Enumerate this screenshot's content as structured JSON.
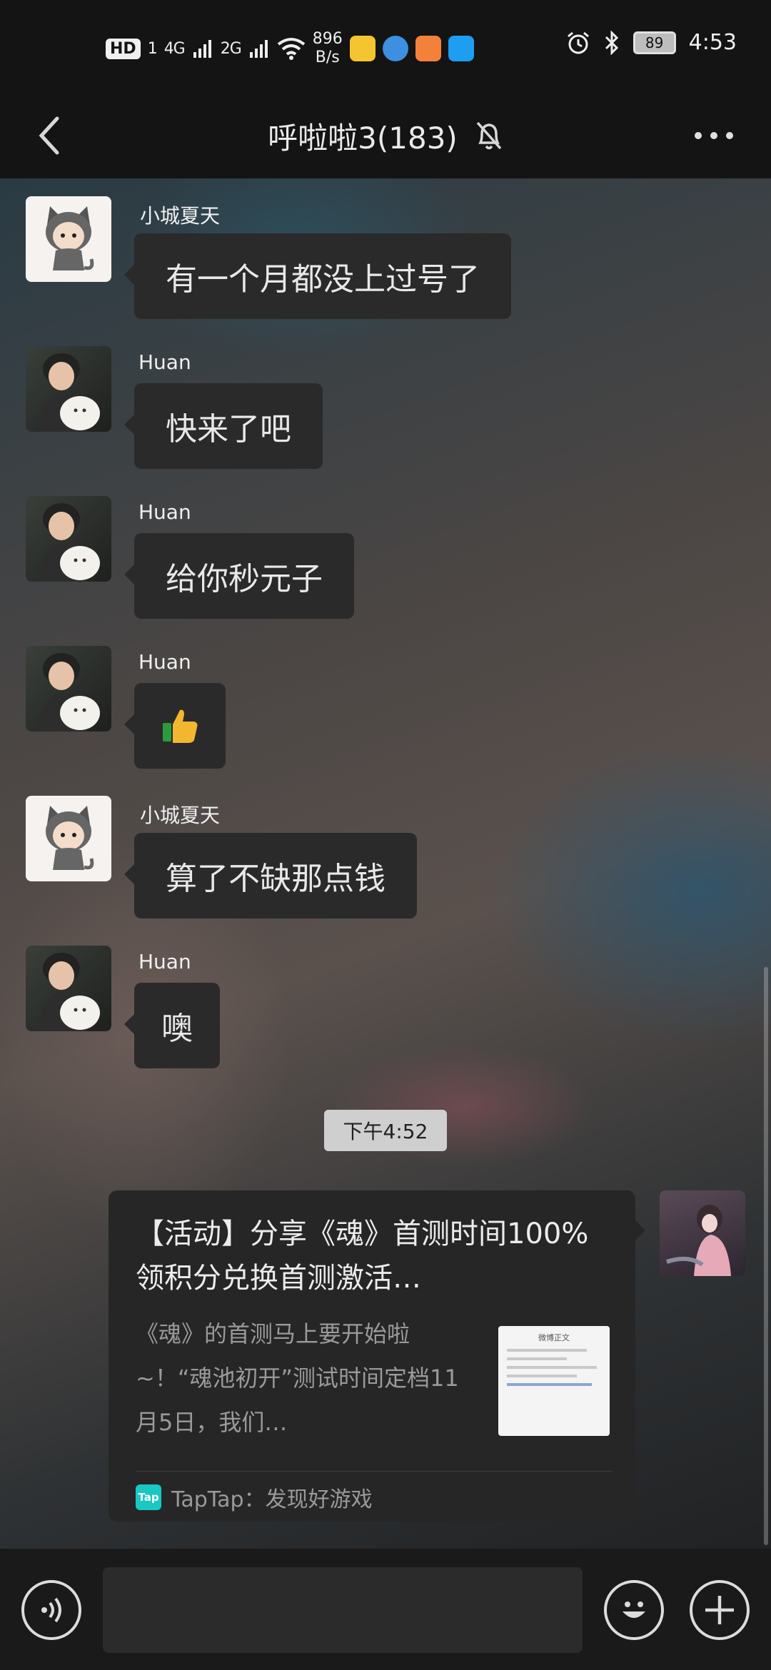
{
  "status_bar": {
    "hd": "HD",
    "sim1": "1",
    "signal_4g": "4G",
    "signal_2g": "2G",
    "net_speed_value": "896",
    "net_speed_unit": "B/s",
    "battery": "89",
    "time": "4:53"
  },
  "header": {
    "title": "呼啦啦3(183)"
  },
  "messages": [
    {
      "sender": "小城夏天",
      "text": "有一个月都没上过号了"
    },
    {
      "sender": "Huan",
      "text": "快来了吧"
    },
    {
      "sender": "Huan",
      "text": "给你秒元子"
    },
    {
      "sender": "Huan",
      "text": "👍"
    },
    {
      "sender": "小城夏天",
      "text": "算了不缺那点钱"
    },
    {
      "sender": "Huan",
      "text": "噢"
    }
  ],
  "timestamp": "下午4:52",
  "share_card": {
    "title": "【活动】分享《魂》首测时间100%领积分兑换首测激活…",
    "body": "《魂》的首测马上要开始啦~！“魂池初开”测试时间定档11月5日，我们…",
    "thumb_header": "微博正文",
    "source_logo": "Tap",
    "source": "TapTap：发现好游戏"
  },
  "input": {
    "placeholder": ""
  },
  "icons": {
    "back": "back-arrow-icon",
    "mute": "bell-muted-icon",
    "more": "more-dots-icon",
    "voice": "voice-icon",
    "emoji": "emoji-icon",
    "add": "plus-icon"
  }
}
